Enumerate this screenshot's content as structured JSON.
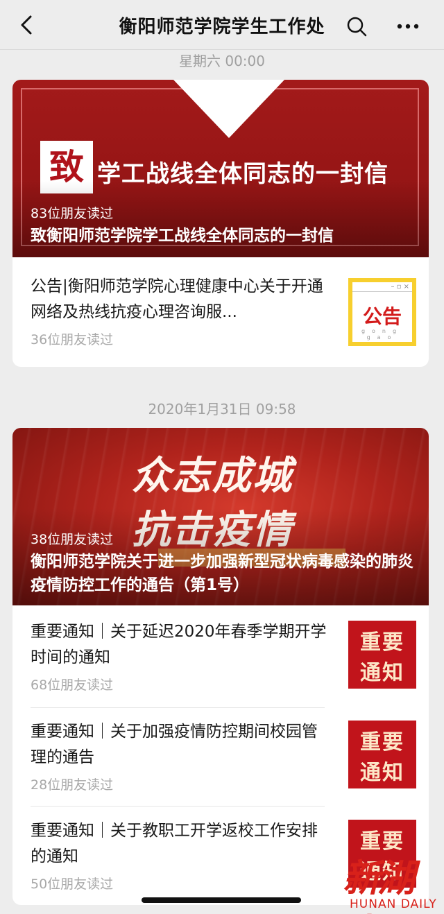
{
  "navbar": {
    "title": "衡阳师范学院学生工作处"
  },
  "groups": [
    {
      "timestamp": "星期六 00:00",
      "hero": {
        "seal_char": "致",
        "headline": "学工战线全体同志的一封信",
        "reads": "83位朋友读过",
        "title": "致衡阳师范学院学工战线全体同志的一封信"
      },
      "items": [
        {
          "title": "公告|衡阳师范学院心理健康中心关于开通网络及热线抗疫心理咨询服...",
          "reads": "36位朋友读过",
          "thumb_text": "公告",
          "thumb_pinyin": "gong  gao",
          "thumb_icon": "gonggao-notice-image"
        }
      ]
    },
    {
      "timestamp": "2020年1月31日 09:58",
      "hero": {
        "line1": "众志成城",
        "line2": "抗击疫情",
        "reads": "38位朋友读过",
        "title": "衡阳师范学院关于进一步加强新型冠状病毒感染的肺炎疫情防控工作的通告（第1号）"
      },
      "items": [
        {
          "title": "重要通知｜关于延迟2020年春季学期开学时间的通知",
          "reads": "68位朋友读过",
          "thumb_line1": "重要",
          "thumb_line2": "通知"
        },
        {
          "title": "重要通知｜关于加强疫情防控期间校园管理的通告",
          "reads": "28位朋友读过",
          "thumb_line1": "重要",
          "thumb_line2": "通知"
        },
        {
          "title": "重要通知｜关于教职工开学返校工作安排的通知",
          "reads": "50位朋友读过",
          "thumb_line1": "重要",
          "thumb_line2": "通知"
        }
      ]
    }
  ],
  "watermark": {
    "logo_text": "新湖南",
    "sub_text": "HUNAN DAILY"
  },
  "colors": {
    "background": "#ededed",
    "card": "#ffffff",
    "hero_red": "#a31a1a",
    "notice_red": "#c1141b",
    "gonggao_yellow": "#f7cf2e",
    "meta_gray": "#a8a8a8"
  }
}
